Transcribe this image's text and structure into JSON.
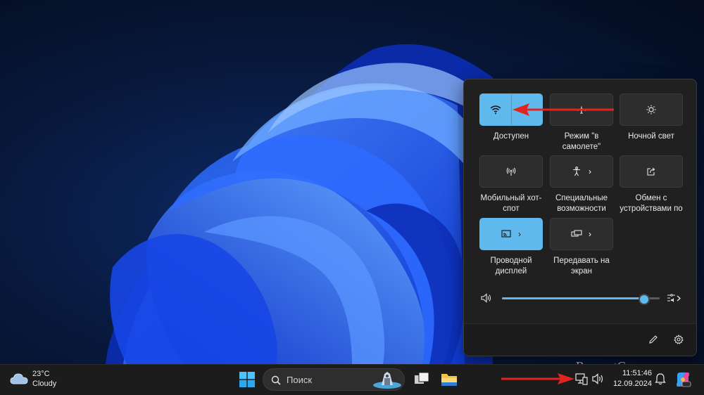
{
  "quick_settings": {
    "tiles": [
      {
        "id": "wifi",
        "label_lines": [
          "Доступен"
        ],
        "active": true,
        "icon": "wifi-icon"
      },
      {
        "id": "airplane",
        "label_lines": [
          "Режим \"в",
          "самолете\""
        ],
        "active": false,
        "icon": "airplane-icon"
      },
      {
        "id": "night-light",
        "label_lines": [
          "Ночной свет"
        ],
        "active": false,
        "icon": "night-light-icon"
      },
      {
        "id": "hotspot",
        "label_lines": [
          "Мобильный хот-",
          "спот"
        ],
        "active": false,
        "icon": "hotspot-icon"
      },
      {
        "id": "accessibility",
        "label_lines": [
          "Специальные",
          "возможности"
        ],
        "active": false,
        "icon": "accessibility-icon"
      },
      {
        "id": "nearby-sharing",
        "label_lines": [
          "Обмен с",
          "устройствами по"
        ],
        "active": false,
        "icon": "share-icon"
      },
      {
        "id": "wired-display",
        "label_lines": [
          "Проводной",
          "дисплей"
        ],
        "active": true,
        "icon": "cast-icon"
      },
      {
        "id": "project",
        "label_lines": [
          "Передавать на",
          "экран"
        ],
        "active": false,
        "icon": "project-icon"
      }
    ],
    "volume_level": 0.9
  },
  "taskbar": {
    "weather": {
      "temp": "23°C",
      "condition": "Cloudy"
    },
    "search_placeholder": "Поиск",
    "clock": {
      "time": "11:51:46",
      "date": "12.09.2024"
    }
  },
  "watermark": "RemontCompa.ru",
  "colors": {
    "accent": "#60b9ec",
    "arrow": "#e3231f",
    "panel": "#202020",
    "taskbar": "#1c1c1c"
  }
}
